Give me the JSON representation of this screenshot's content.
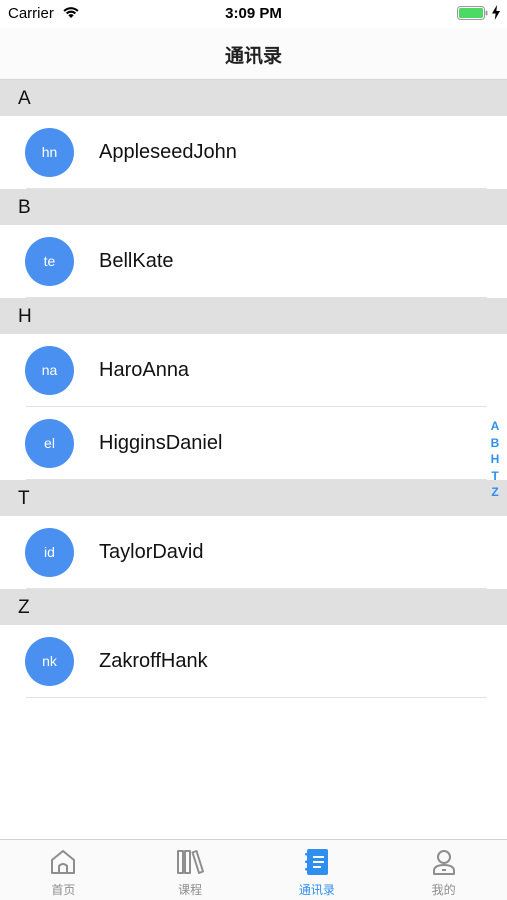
{
  "status_bar": {
    "carrier": "Carrier",
    "time": "3:09 PM"
  },
  "nav": {
    "title": "通讯录"
  },
  "sections": [
    {
      "letter": "A",
      "contacts": [
        {
          "initials": "hn",
          "name": "AppleseedJohn"
        }
      ]
    },
    {
      "letter": "B",
      "contacts": [
        {
          "initials": "te",
          "name": "BellKate"
        }
      ]
    },
    {
      "letter": "H",
      "contacts": [
        {
          "initials": "na",
          "name": "HaroAnna"
        },
        {
          "initials": "el",
          "name": "HigginsDaniel"
        }
      ]
    },
    {
      "letter": "T",
      "contacts": [
        {
          "initials": "id",
          "name": "TaylorDavid"
        }
      ]
    },
    {
      "letter": "Z",
      "contacts": [
        {
          "initials": "nk",
          "name": "ZakroffHank"
        }
      ]
    }
  ],
  "index": [
    "A",
    "B",
    "H",
    "T",
    "Z"
  ],
  "tabs": [
    {
      "label": "首页",
      "icon": "home-icon",
      "active": false
    },
    {
      "label": "课程",
      "icon": "books-icon",
      "active": false
    },
    {
      "label": "通讯录",
      "icon": "address-book-icon",
      "active": true
    },
    {
      "label": "我的",
      "icon": "profile-icon",
      "active": false
    }
  ],
  "colors": {
    "accent": "#2f8ff0",
    "avatar": "#4a90f0",
    "section_header": "#e0e0e0",
    "battery": "#4cd964",
    "tab_inactive": "#8e8e8e"
  }
}
